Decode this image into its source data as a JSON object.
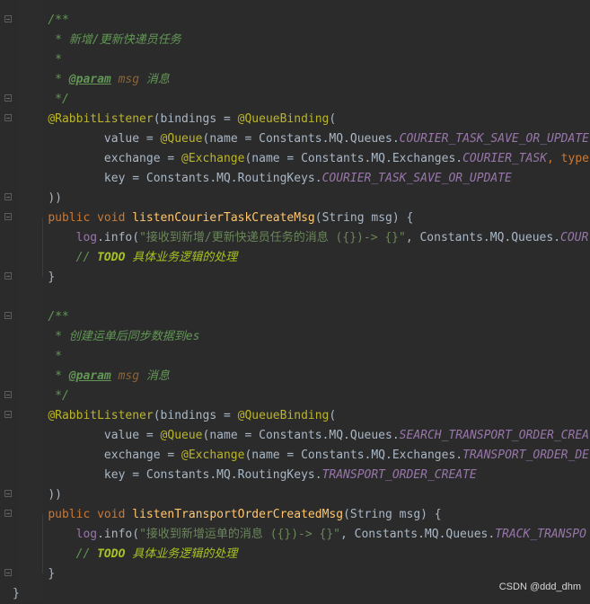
{
  "code": {
    "block1": {
      "doc_open": "/**",
      "doc_desc": "* 新增/更新快递员任务",
      "doc_star": "*",
      "param_tag": "@param",
      "param_name": "msg",
      "param_desc": "消息",
      "doc_close": "*/",
      "annotation": "@RabbitListener",
      "annotation_rest": "(bindings = ",
      "queue_binding": "@QueueBinding",
      "paren_open": "(",
      "value_prefix": "value = ",
      "queue_ann": "@Queue",
      "value_mid": "(name = Constants.MQ.Queues.",
      "value_const": "COURIER_TASK_SAVE_OR_UPDATE",
      "exchange_prefix": "exchange = ",
      "exchange_ann": "@Exchange",
      "exchange_mid": "(name = Constants.MQ.Exchanges.",
      "exchange_const": "COURIER_TASK",
      "exchange_tail": ", type",
      "key_prefix": "key = Constants.MQ.RoutingKeys.",
      "key_const": "COURIER_TASK_SAVE_OR_UPDATE",
      "close_binding": "))",
      "kw_public": "public",
      "kw_void": "void",
      "method_name": "listenCourierTaskCreateMsg",
      "method_params": "(String msg) {",
      "log_field": "log",
      "log_call": ".info(",
      "log_string": "\"接收到新增/更新快递员任务的消息 ({})-> {}\"",
      "log_args": ", Constants.MQ.Queues.",
      "log_const": "COUR",
      "todo_comment_prefix": "// ",
      "todo_label": "TODO",
      "todo_text": " 具体业务逻辑的处理",
      "close_brace": "}"
    },
    "block2": {
      "doc_open": "/**",
      "doc_desc": "* 创建运单后同步数据到es",
      "doc_star": "*",
      "param_tag": "@param",
      "param_name": "msg",
      "param_desc": "消息",
      "doc_close": "*/",
      "annotation": "@RabbitListener",
      "annotation_rest": "(bindings = ",
      "queue_binding": "@QueueBinding",
      "paren_open": "(",
      "value_prefix": "value = ",
      "queue_ann": "@Queue",
      "value_mid": "(name = Constants.MQ.Queues.",
      "value_const": "SEARCH_TRANSPORT_ORDER_CREA",
      "exchange_prefix": "exchange = ",
      "exchange_ann": "@Exchange",
      "exchange_mid": "(name = Constants.MQ.Exchanges.",
      "exchange_const": "TRANSPORT_ORDER_DE",
      "key_prefix": "key = Constants.MQ.RoutingKeys.",
      "key_const": "TRANSPORT_ORDER_CREATE",
      "close_binding": "))",
      "kw_public": "public",
      "kw_void": "void",
      "method_name": "listenTransportOrderCreatedMsg",
      "method_params": "(String msg) {",
      "log_field": "log",
      "log_call": ".info(",
      "log_string": "\"接收到新增运单的消息 ({})-> {}\"",
      "log_args": ", Constants.MQ.Queues.",
      "log_const": "TRACK_TRANSPO",
      "todo_comment_prefix": "// ",
      "todo_label": "TODO",
      "todo_text": " 具体业务逻辑的处理",
      "close_brace": "}"
    },
    "class_close": "}"
  },
  "watermark": "CSDN @ddd_dhm",
  "colors": {
    "background": "#2b2b2b",
    "comment": "#629755",
    "keyword": "#cc7832",
    "annotation": "#bbb529",
    "method": "#ffc66d",
    "string": "#6a8759",
    "constant": "#9876aa",
    "todo": "#a8c023"
  }
}
